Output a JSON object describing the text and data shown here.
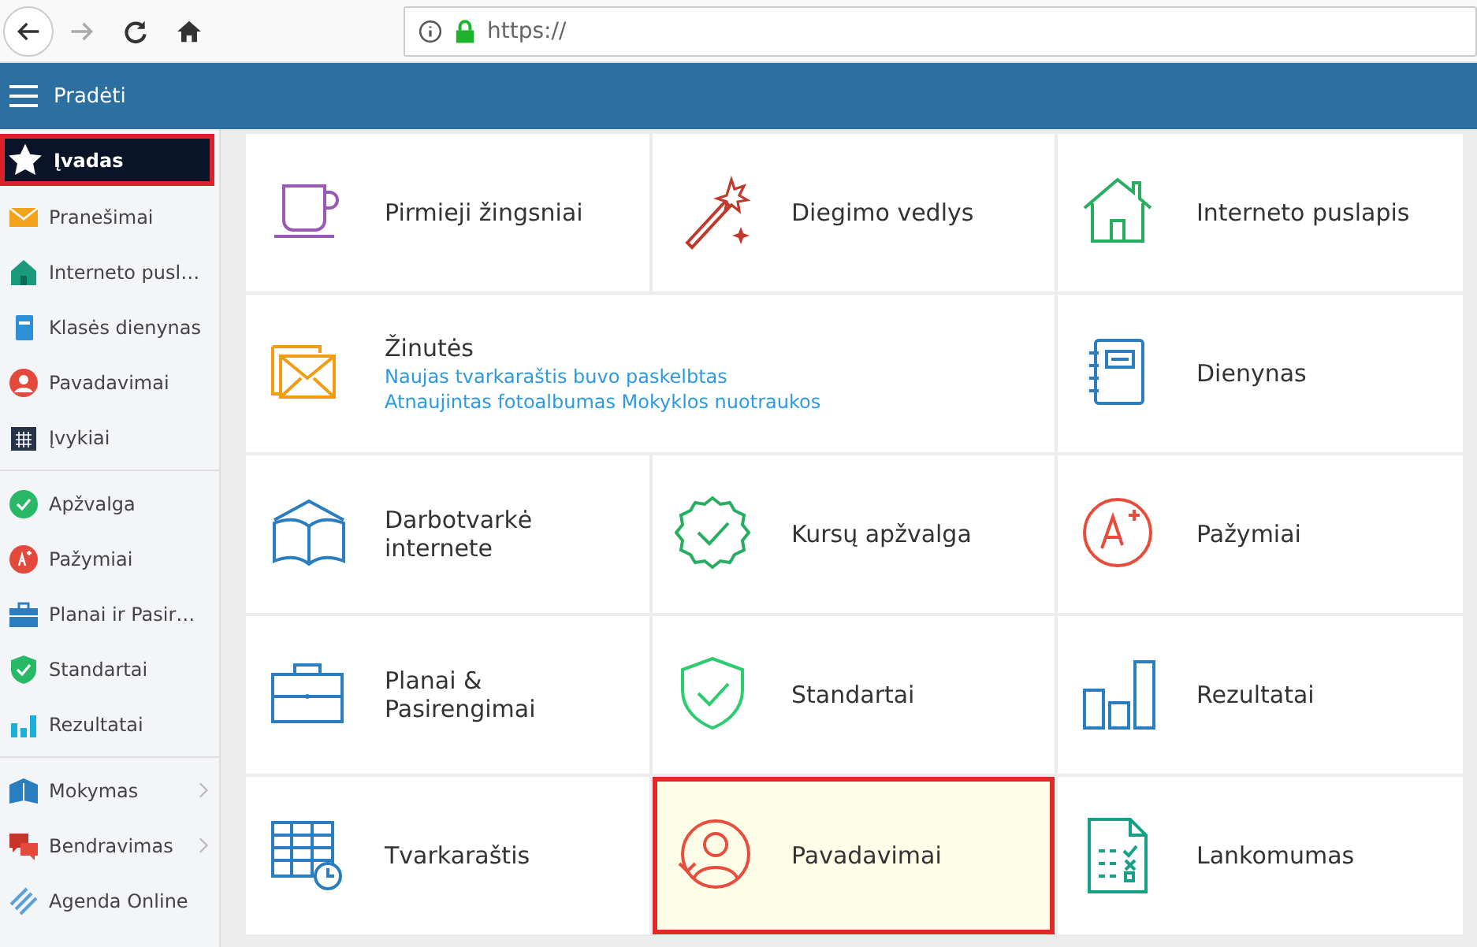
{
  "browser": {
    "url": "https://"
  },
  "header": {
    "title": "Pradėti"
  },
  "sidebar": {
    "groups": [
      [
        {
          "label": "Įvadas",
          "selected": true,
          "submenu": false
        },
        {
          "label": "Pranešimai",
          "selected": false,
          "submenu": false
        },
        {
          "label": "Interneto pusl…",
          "selected": false,
          "submenu": false
        },
        {
          "label": "Klasės dienynas",
          "selected": false,
          "submenu": false
        },
        {
          "label": "Pavadavimai",
          "selected": false,
          "submenu": false
        },
        {
          "label": "Įvykiai",
          "selected": false,
          "submenu": false
        }
      ],
      [
        {
          "label": "Apžvalga",
          "selected": false,
          "submenu": false
        },
        {
          "label": "Pažymiai",
          "selected": false,
          "submenu": false
        },
        {
          "label": "Planai ir Pasir…",
          "selected": false,
          "submenu": false
        },
        {
          "label": "Standartai",
          "selected": false,
          "submenu": false
        },
        {
          "label": "Rezultatai",
          "selected": false,
          "submenu": false
        }
      ],
      [
        {
          "label": "Mokymas",
          "selected": false,
          "submenu": true
        },
        {
          "label": "Bendravimas",
          "selected": false,
          "submenu": true
        },
        {
          "label": "Agenda Online",
          "selected": false,
          "submenu": false
        }
      ]
    ]
  },
  "tiles": [
    {
      "kind": "tile",
      "label": "Pirmieji žingsniai",
      "selected": false
    },
    {
      "kind": "tile",
      "label": "Diegimo vedlys",
      "selected": false
    },
    {
      "kind": "tile",
      "label": "Interneto puslapis",
      "selected": false
    },
    {
      "kind": "messages",
      "label": "Žinutės",
      "selected": false,
      "links": [
        "Naujas tvarkaraštis buvo paskelbtas",
        "Atnaujintas fotoalbumas Mokyklos nuotraukos"
      ]
    },
    {
      "kind": "tile",
      "label": "Dienynas",
      "selected": false
    },
    {
      "kind": "tile",
      "label": "Darbotvarkė internete",
      "selected": false
    },
    {
      "kind": "tile",
      "label": "Kursų apžvalga",
      "selected": false
    },
    {
      "kind": "tile",
      "label": "Pažymiai",
      "selected": false
    },
    {
      "kind": "tile",
      "label": "Planai & Pasirengimai",
      "selected": false
    },
    {
      "kind": "tile",
      "label": "Standartai",
      "selected": false
    },
    {
      "kind": "tile",
      "label": "Rezultatai",
      "selected": false
    },
    {
      "kind": "tile",
      "label": "Tvarkaraštis",
      "selected": false
    },
    {
      "kind": "tile",
      "label": "Pavadavimai",
      "selected": true
    },
    {
      "kind": "tile",
      "label": "Lankomumas",
      "selected": false
    }
  ]
}
